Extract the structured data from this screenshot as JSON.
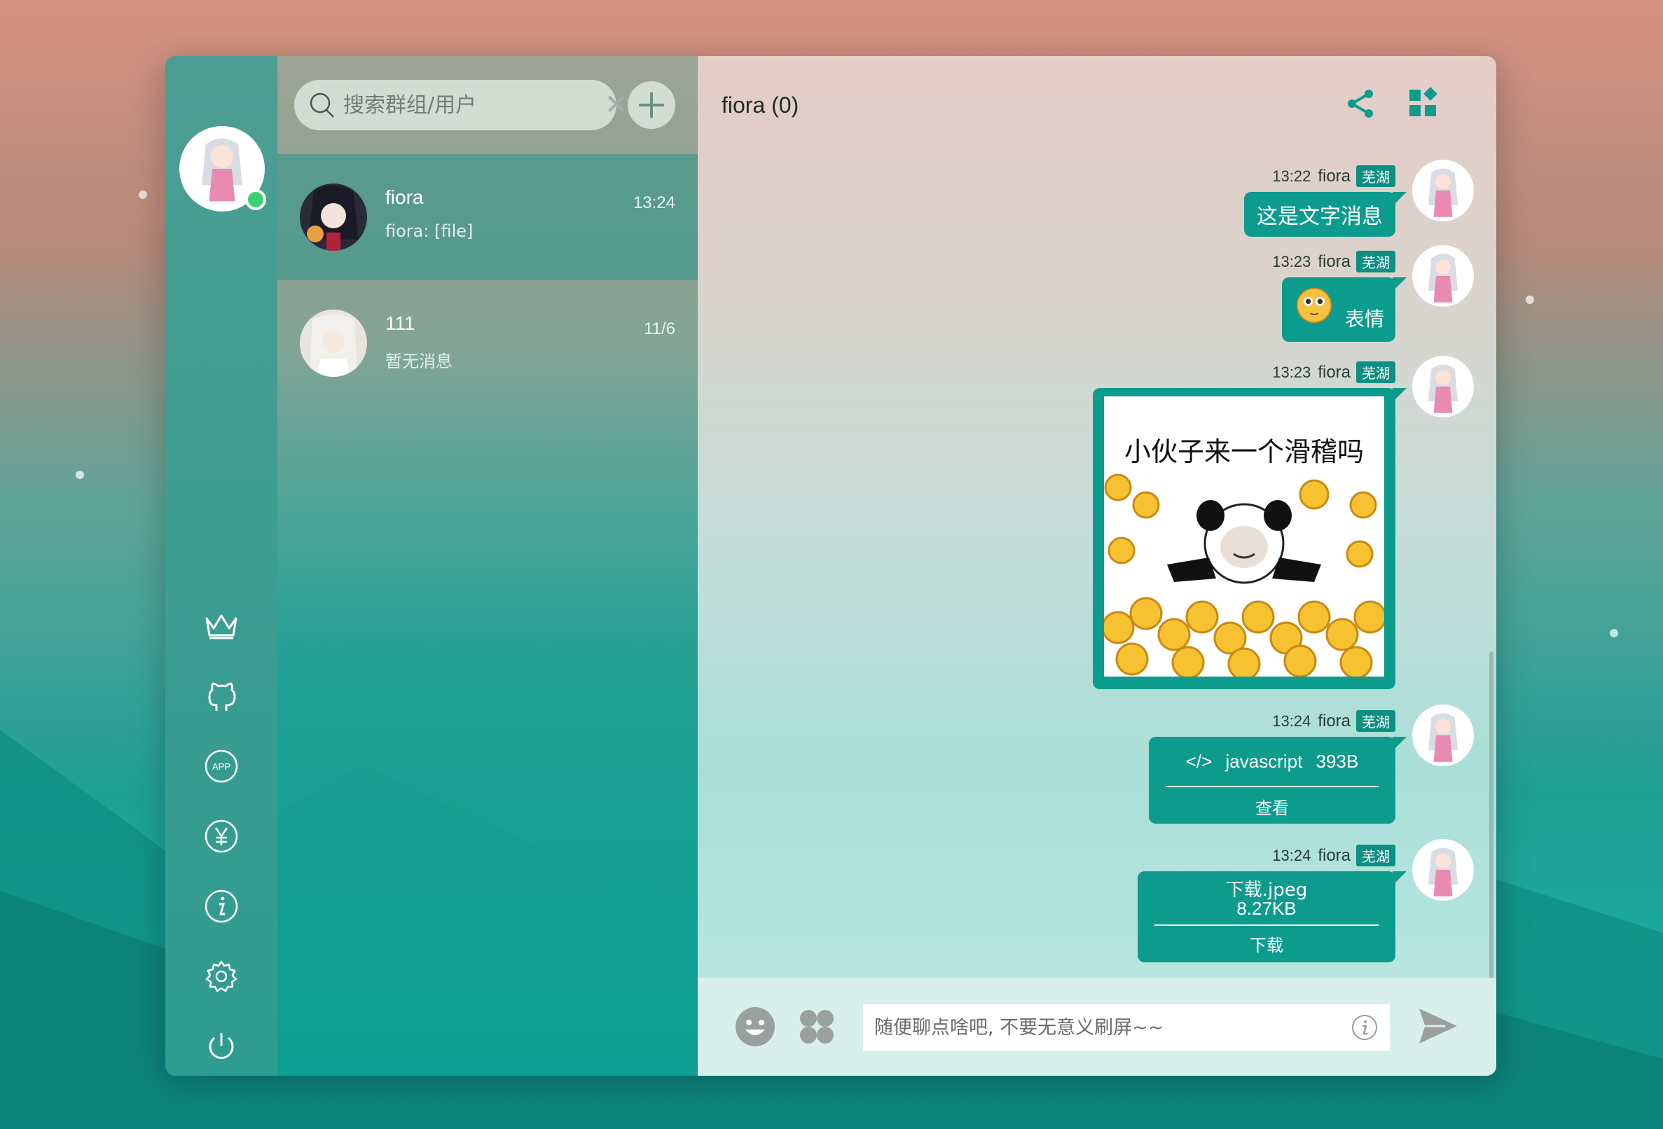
{
  "search": {
    "placeholder": "搜索群组/用户"
  },
  "conversations": [
    {
      "name": "fiora",
      "time": "13:24",
      "preview": "fiora: [file]"
    },
    {
      "name": "111",
      "time": "11/6",
      "preview": "暂无消息"
    }
  ],
  "chat": {
    "title": "fiora (0)",
    "messages": [
      {
        "time": "13:22",
        "name": "fiora",
        "tag": "芜湖",
        "type": "text",
        "text": "这是文字消息"
      },
      {
        "time": "13:23",
        "name": "fiora",
        "tag": "芜湖",
        "type": "expression",
        "text": "表情"
      },
      {
        "time": "13:23",
        "name": "fiora",
        "tag": "芜湖",
        "type": "image",
        "image_caption": "小伙子来一个滑稽吗"
      },
      {
        "time": "13:24",
        "name": "fiora",
        "tag": "芜湖",
        "type": "code",
        "language": "javascript",
        "size": "393B",
        "action": "查看"
      },
      {
        "time": "13:24",
        "name": "fiora",
        "tag": "芜湖",
        "type": "file",
        "filename": "下载.jpeg",
        "size": "8.27KB",
        "action": "下载"
      }
    ]
  },
  "composer": {
    "placeholder": "随便聊点啥吧, 不要无意义刷屏~~"
  },
  "nav_icons": [
    "crown-icon",
    "github-icon",
    "app-icon",
    "yen-icon",
    "info-icon",
    "settings-icon",
    "power-icon"
  ],
  "colors": {
    "accent": "#0d9b8e",
    "online": "#3bd16f"
  }
}
